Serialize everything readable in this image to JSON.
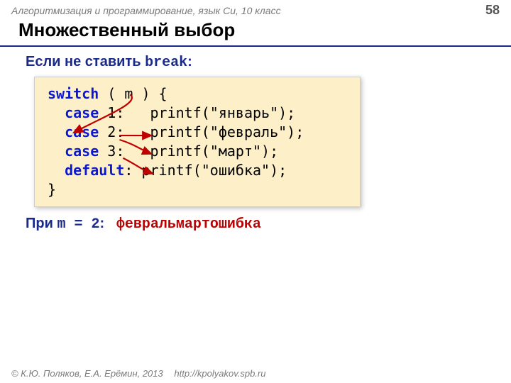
{
  "header": {
    "course": "Алгоритмизация и программирование, язык Си, 10 класс",
    "page": "58"
  },
  "title": "Множественный выбор",
  "intro": {
    "prefix": "Если не ставить ",
    "keyword": "break",
    "suffix": ":"
  },
  "code": {
    "l1a": "switch",
    "l1b": " ( m ) {",
    "l2a": "case",
    "l2b": " 1:   printf(\"январь\");",
    "l3a": "case",
    "l3b": " 2:   printf(\"февраль\");",
    "l4a": "case",
    "l4b": " 3:   printf(\"март\");",
    "l5a": "default",
    "l5b": ": printf(\"ошибка\");",
    "l6": "}"
  },
  "result": {
    "prefix": "При ",
    "var": "m = 2",
    "suffix": ":",
    "output": "февральмартошибка"
  },
  "footer": {
    "copyright": "© К.Ю. Поляков, Е.А. Ерёмин, 2013",
    "url": "http://kpolyakov.spb.ru"
  }
}
